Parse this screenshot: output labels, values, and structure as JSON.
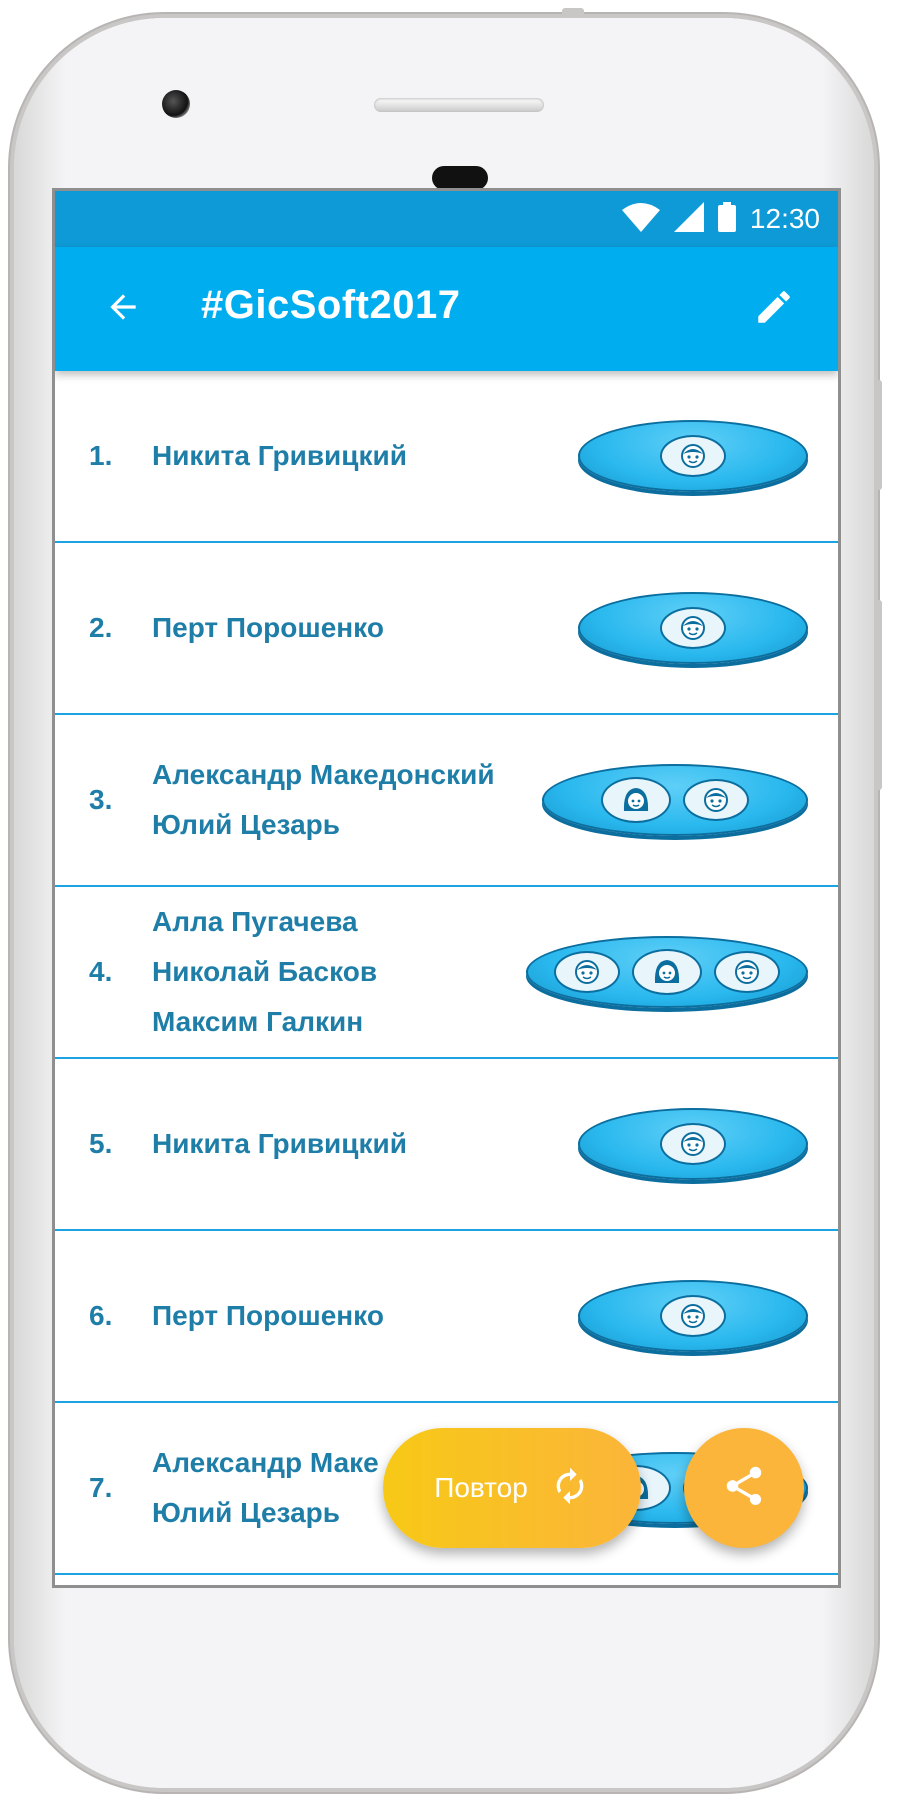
{
  "status_bar": {
    "time": "12:30",
    "icons": [
      "wifi-icon",
      "signal-icon",
      "battery-icon"
    ]
  },
  "app_bar": {
    "back_icon": "arrow-left-icon",
    "title": "#GicSoft2017",
    "edit_icon": "pencil-icon"
  },
  "list": {
    "rows": [
      {
        "number": "1.",
        "names": [
          "Никита Гривицкий"
        ],
        "avatars": [
          "boy"
        ]
      },
      {
        "number": "2.",
        "names": [
          "Перт Порошенко"
        ],
        "avatars": [
          "boy"
        ]
      },
      {
        "number": "3.",
        "names": [
          "Александр Македонский",
          "Юлий Цезарь"
        ],
        "avatars": [
          "girl",
          "boy"
        ]
      },
      {
        "number": "4.",
        "names": [
          "Алла Пугачева",
          "Николай Басков",
          "Максим Галкин"
        ],
        "avatars": [
          "boy",
          "girl",
          "boy"
        ]
      },
      {
        "number": "5.",
        "names": [
          "Никита Гривицкий"
        ],
        "avatars": [
          "boy"
        ]
      },
      {
        "number": "6.",
        "names": [
          "Перт Порошенко"
        ],
        "avatars": [
          "boy"
        ]
      },
      {
        "number": "7.",
        "names": [
          "Александр Маке",
          "Юлий Цезарь"
        ],
        "avatars": [
          "girl",
          "boy"
        ]
      }
    ]
  },
  "actions": {
    "repeat_label": "Повтор",
    "repeat_icon": "refresh-icon",
    "share_icon": "share-icon"
  },
  "colors": {
    "status_bar": "#0e9ad6",
    "app_bar": "#00adef",
    "text": "#1e7ea8",
    "divider": "#1aa3e0",
    "fab": "#fbb53a"
  }
}
